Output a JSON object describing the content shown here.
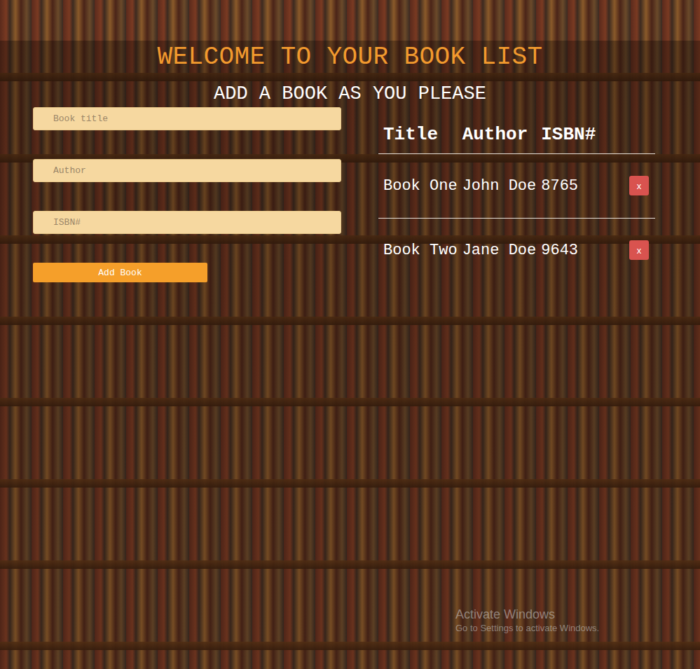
{
  "page": {
    "title": "WELCOME TO YOUR BOOK LIST",
    "subtitle": "ADD A BOOK AS YOU PLEASE"
  },
  "form": {
    "fields": [
      {
        "placeholder": "Book title"
      },
      {
        "placeholder": "Author"
      },
      {
        "placeholder": "ISBN#"
      }
    ],
    "button": "Add Book"
  },
  "table": {
    "columns": [
      "Title",
      "Author",
      "ISBN#"
    ],
    "rows": [
      {
        "title": "Book One",
        "author": "John Doe",
        "isbn": "8765",
        "delete": "x"
      },
      {
        "title": "Book Two",
        "author": "Jane Doe",
        "isbn": "9643",
        "delete": "x"
      }
    ]
  },
  "watermark": {
    "title": "Activate Windows",
    "subtitle": "Go to Settings to activate Windows."
  }
}
